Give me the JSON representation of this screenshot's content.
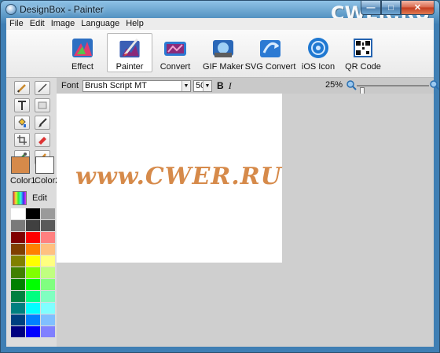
{
  "window": {
    "title": "DesignBox - Painter",
    "watermark": "CWER.RU",
    "minimize_glyph": "—",
    "maximize_glyph": "□",
    "close_glyph": "✕"
  },
  "menu": [
    "File",
    "Edit",
    "Image",
    "Language",
    "Help"
  ],
  "toolbar": {
    "items": [
      {
        "label": "Effect",
        "icon": "effect-icon",
        "active": false
      },
      {
        "label": "Painter",
        "icon": "painter-icon",
        "active": true
      },
      {
        "label": "Convert",
        "icon": "convert-icon",
        "active": false
      },
      {
        "label": "GIF Maker",
        "icon": "gif-maker-icon",
        "active": false
      },
      {
        "label": "SVG Convert",
        "icon": "svg-convert-icon",
        "active": false
      },
      {
        "label": "iOS Icon",
        "icon": "ios-icon-icon",
        "active": false
      },
      {
        "label": "QR Code",
        "icon": "qr-code-icon",
        "active": false
      }
    ]
  },
  "tools": [
    "pencil-icon",
    "line-icon",
    "text-icon",
    "rectangle-icon",
    "fill-bucket-icon",
    "brush-icon",
    "crop-icon",
    "eraser-icon",
    "eyedropper-icon",
    "spray-icon"
  ],
  "colors": {
    "color1_label": "Color1",
    "color1": "#d68a4a",
    "color2_label": "Color2",
    "color2": "#ffffff",
    "edit_label": "Edit",
    "palette": [
      "#ffffff",
      "#000000",
      "#9a9a9a",
      "#7a7a7a",
      "#404040",
      "#5a5a5a",
      "#800000",
      "#ff0000",
      "#ff8080",
      "#804000",
      "#ff8000",
      "#ffc080",
      "#808000",
      "#ffff00",
      "#ffff80",
      "#408000",
      "#80ff00",
      "#c0ff80",
      "#008000",
      "#00ff00",
      "#80ff80",
      "#008040",
      "#00ff80",
      "#80ffc0",
      "#008080",
      "#00ffff",
      "#80ffff",
      "#004080",
      "#0080ff",
      "#80c0ff",
      "#000080",
      "#0000ff",
      "#8080ff"
    ]
  },
  "fontbar": {
    "font_label": "Font",
    "font_value": "Brush Script MT",
    "size_value": "50",
    "bold_label": "B",
    "italic_label": "I",
    "zoom_value": "25%",
    "zoom_fraction": 0.04
  },
  "canvas": {
    "text": "www.CWER.RU",
    "text_color": "#d68a4a"
  }
}
